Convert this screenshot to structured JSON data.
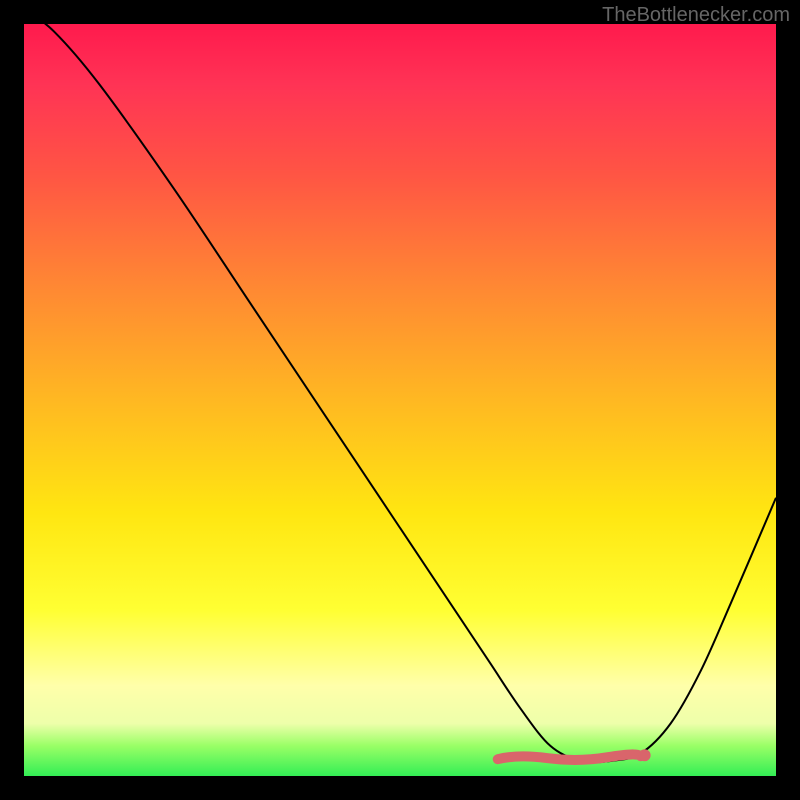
{
  "watermark": "TheBottlenecker.com",
  "chart_data": {
    "type": "line",
    "title": "",
    "xlabel": "",
    "ylabel": "",
    "xlim": [
      0,
      100
    ],
    "ylim": [
      0,
      100
    ],
    "description": "Bottleneck curve over rainbow gradient background. Y-axis represents bottleneck percentage (red=high, green=low). Curve drops from top-left to a minimum valley around x≈70-80 then rises toward the right.",
    "series": [
      {
        "name": "bottleneck-curve",
        "x": [
          0,
          4,
          10,
          20,
          30,
          40,
          50,
          58,
          62,
          66,
          70,
          74,
          78,
          82,
          86,
          90,
          94,
          100
        ],
        "values": [
          102,
          99,
          92,
          78,
          63,
          48,
          33,
          21,
          15,
          9,
          4,
          2,
          2,
          3,
          7,
          14,
          23,
          37
        ]
      }
    ],
    "optimal_region": {
      "x_start": 63,
      "x_end": 82,
      "y": 2.5
    },
    "gradient_stops": [
      {
        "pct": 0,
        "color": "#ff1a4d"
      },
      {
        "pct": 20,
        "color": "#ff5544"
      },
      {
        "pct": 50,
        "color": "#ffb822"
      },
      {
        "pct": 78,
        "color": "#ffff33"
      },
      {
        "pct": 96,
        "color": "#99ff66"
      },
      {
        "pct": 100,
        "color": "#33ee55"
      }
    ]
  }
}
